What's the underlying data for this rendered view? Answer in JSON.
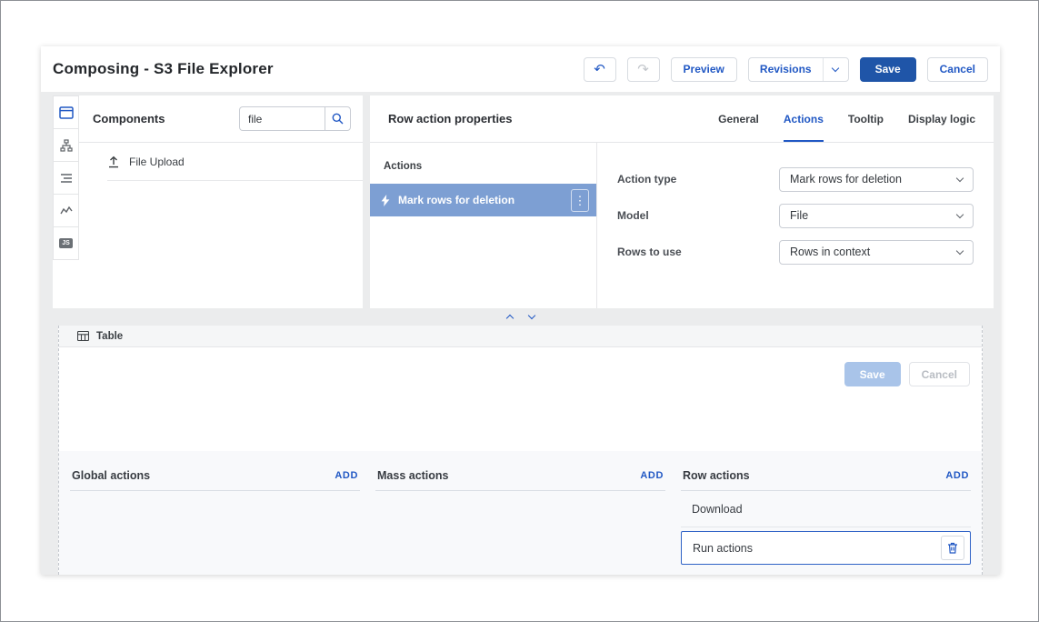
{
  "app": {
    "title": "Composing - S3 File Explorer"
  },
  "toolbar": {
    "preview": "Preview",
    "revisions": "Revisions",
    "save": "Save",
    "cancel": "Cancel"
  },
  "icons": {
    "undo": "↶",
    "redo": "↷",
    "kebab": "⋮"
  },
  "components_panel": {
    "title": "Components",
    "search_value": "file",
    "items": [
      {
        "label": "File Upload"
      }
    ]
  },
  "properties_panel": {
    "title": "Row action properties",
    "tabs": [
      {
        "label": "General"
      },
      {
        "label": "Actions"
      },
      {
        "label": "Tooltip"
      },
      {
        "label": "Display logic"
      }
    ],
    "active_tab": "Actions",
    "actions_list": {
      "title": "Actions",
      "selected_item": "Mark rows for deletion"
    },
    "fields": [
      {
        "label": "Action type",
        "value": "Mark rows for deletion"
      },
      {
        "label": "Model",
        "value": "File"
      },
      {
        "label": "Rows to use",
        "value": "Rows in context"
      }
    ]
  },
  "canvas": {
    "table_label": "Table",
    "save": "Save",
    "cancel": "Cancel",
    "columns": [
      {
        "title": "Global actions",
        "add": "ADD"
      },
      {
        "title": "Mass actions",
        "add": "ADD"
      },
      {
        "title": "Row actions",
        "add": "ADD"
      }
    ],
    "row_actions": [
      {
        "label": "Download",
        "selected": false
      },
      {
        "label": "Run actions",
        "selected": true
      }
    ]
  },
  "colors": {
    "primary": "#1f55a8",
    "link": "#2158c4",
    "selected_action_bg": "#7d9fd3"
  }
}
